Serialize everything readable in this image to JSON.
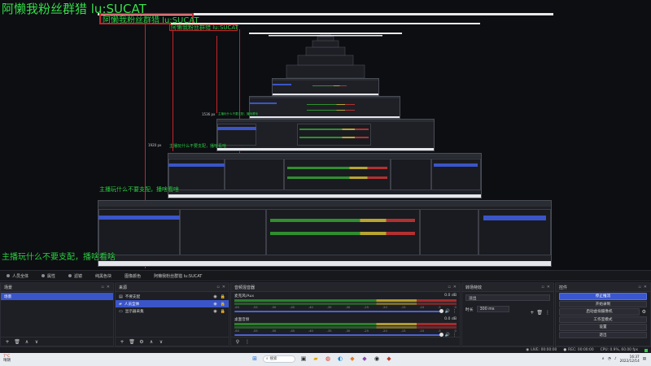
{
  "overlay": {
    "scene_title": "阿懒我粉丝群猎 lu:SUCAT",
    "capture_title_1": "阿懒我粉丝群猎 lu:SUCAT",
    "capture_title_2": "阿懒我粉丝群猎 lu:SUCAT",
    "tagline_main": "主播玩什么不要支配，播啥看啥",
    "tagline_mid": "主播玩什么不要支配，播啥看啥",
    "tagline_small": "主播玩什么不要支配，播啥看啥",
    "tagline_tiny": "主播玩什么不要支配，播啥看啥",
    "res_label": "1536 px",
    "res_label_small": "1920 px",
    "colors": {
      "text_green": "#31d14a",
      "box_red": "#c3242b",
      "accent_blue": "#3a55c8"
    }
  },
  "toolbar": {
    "items": [
      {
        "icon": "scene-icon",
        "label": "人员全体"
      },
      {
        "icon": "properties-icon",
        "label": "属性"
      },
      {
        "icon": "filters-icon",
        "label": "滤镜"
      },
      {
        "icon": "color-icon",
        "label": "纯黑色块"
      },
      {
        "icon": "image-icon",
        "label": "图像颜色"
      },
      {
        "icon": "text-icon",
        "label": "阿懒我粉丝群猎 lu:SUCAT"
      }
    ]
  },
  "scenes": {
    "title": "场景",
    "items": [
      {
        "label": "场景",
        "selected": true
      }
    ]
  },
  "sources": {
    "title": "来源",
    "items": [
      {
        "icon": "text-icon",
        "label": "不要支配",
        "selected": false
      },
      {
        "icon": "folder-icon",
        "label": "人员全体",
        "selected": true
      },
      {
        "icon": "monitor-icon",
        "label": "显示器采集",
        "selected": false
      }
    ]
  },
  "mixer": {
    "title": "音频混音器",
    "channels": [
      {
        "name": "麦克风/Aux",
        "db": "0.0 dB"
      },
      {
        "name": "桌面音频",
        "db": "0.0 dB"
      }
    ],
    "ticks": [
      "-60",
      "-55",
      "-50",
      "-45",
      "-40",
      "-35",
      "-30",
      "-25",
      "-20",
      "-15",
      "-10",
      "-5",
      "0"
    ]
  },
  "transitions": {
    "title": "转场特效",
    "selected": "淡出",
    "duration_label": "时长",
    "duration_value": "300 ms"
  },
  "controls": {
    "title": "控件",
    "buttons": [
      {
        "label": "停止推流",
        "primary": true
      },
      {
        "label": "开始录制",
        "primary": false
      },
      {
        "label": "启动虚拟摄像机",
        "primary": false
      },
      {
        "label": "工作室模式",
        "primary": false
      },
      {
        "label": "设置",
        "primary": false
      },
      {
        "label": "退出",
        "primary": false
      }
    ]
  },
  "statusbar": {
    "live": "LIVE: 00:00:00",
    "rec": "REC: 00:00:00",
    "cpu": "CPU: 0.9%, 60.00 fps"
  },
  "taskbar": {
    "weather_temp": "7°C",
    "weather_desc": "晴朗",
    "search_placeholder": "搜索",
    "time": "16:37",
    "date": "2022/12/14"
  }
}
